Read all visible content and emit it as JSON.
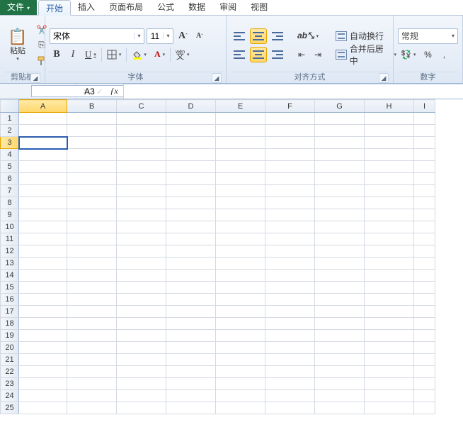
{
  "tabs": {
    "file": "文件",
    "home": "开始",
    "insert": "插入",
    "layout": "页面布局",
    "formulas": "公式",
    "data": "数据",
    "review": "审阅",
    "view": "视图"
  },
  "clipboard": {
    "paste": "粘贴",
    "group": "剪贴板"
  },
  "font": {
    "name": "宋体",
    "size": "11",
    "group": "字体",
    "bold": "B",
    "italic": "I",
    "underline": "U",
    "grow": "A",
    "grow_sup": "ˆ",
    "shrink": "A",
    "shrink_sup": "ˇ",
    "phonetic": "wén",
    "phonetic_sub": "文",
    "fontcolor": "A"
  },
  "align": {
    "group": "对齐方式",
    "wrap": "自动换行",
    "merge": "合并后居中"
  },
  "number": {
    "group": "数字",
    "format": "常规",
    "currency": "%",
    "thousand": ","
  },
  "cellref": "A3",
  "formula": "",
  "cols": [
    "A",
    "B",
    "C",
    "D",
    "E",
    "F",
    "G",
    "H",
    "I"
  ],
  "rows": [
    "1",
    "2",
    "3",
    "4",
    "5",
    "6",
    "7",
    "8",
    "9",
    "10",
    "11",
    "12",
    "13",
    "14",
    "15",
    "16",
    "17",
    "18",
    "19",
    "20",
    "21",
    "22",
    "23",
    "24",
    "25"
  ],
  "selected_row": "3",
  "selected_col": "A"
}
